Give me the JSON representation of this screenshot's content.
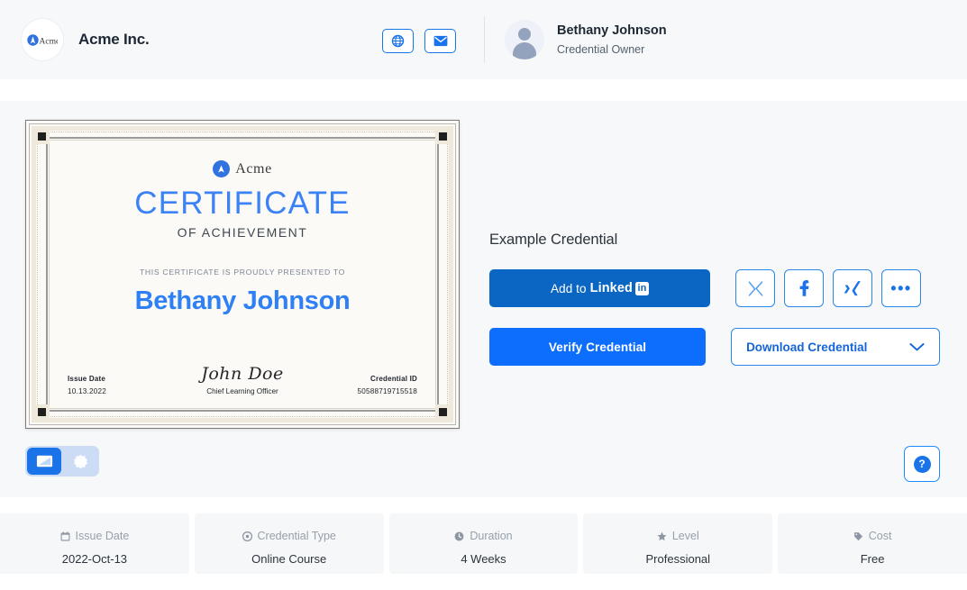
{
  "header": {
    "issuer_name": "Acme Inc.",
    "logo_text": "Acme",
    "actions": [
      {
        "name": "website-button",
        "icon": "globe-icon"
      },
      {
        "name": "email-button",
        "icon": "envelope-icon"
      }
    ],
    "owner": {
      "name": "Bethany Johnson",
      "role": "Credential Owner"
    }
  },
  "certificate": {
    "brand": "Acme",
    "title": "CERTIFICATE",
    "subtitle": "OF ACHIEVEMENT",
    "presented_line": "THIS CERTIFICATE IS PROUDLY PRESENTED TO",
    "recipient": "Bethany Johnson",
    "issue_date_label": "Issue Date",
    "issue_date_value": "10.13.2022",
    "signature_name": "John Doe",
    "signature_role": "Chief Learning Officer",
    "credential_id_label": "Credential ID",
    "credential_id_value": "50588719715518"
  },
  "view_toggle": {
    "options": [
      {
        "name": "certificate-view",
        "icon": "certificate-icon",
        "active": true
      },
      {
        "name": "badge-view",
        "icon": "badge-icon",
        "active": false
      }
    ]
  },
  "help": {
    "label": "?"
  },
  "panel": {
    "title": "Example Credential",
    "linkedin": {
      "prefix": "Add to",
      "brand": "Linked",
      "badge": "in"
    },
    "verify_label": "Verify Credential",
    "download_label": "Download Credential",
    "download_caret": "chevron-down-icon",
    "social": [
      {
        "name": "share-x-button",
        "icon": "x-twitter-icon",
        "glyph": "X"
      },
      {
        "name": "share-facebook-button",
        "icon": "facebook-icon",
        "glyph": "f"
      },
      {
        "name": "share-xing-button",
        "icon": "xing-icon",
        "glyph": "x"
      },
      {
        "name": "share-more-button",
        "icon": "ellipsis-icon",
        "glyph": "•••"
      }
    ]
  },
  "meta": [
    {
      "name": "issue-date",
      "icon": "calendar-icon",
      "label": "Issue Date",
      "value": "2022-Oct-13"
    },
    {
      "name": "credential-type",
      "icon": "disc-icon",
      "label": "Credential Type",
      "value": "Online Course"
    },
    {
      "name": "duration",
      "icon": "clock-icon",
      "label": "Duration",
      "value": "4 Weeks"
    },
    {
      "name": "level",
      "icon": "star-icon",
      "label": "Level",
      "value": "Professional"
    },
    {
      "name": "cost",
      "icon": "tag-icon",
      "label": "Cost",
      "value": "Free"
    }
  ],
  "colors": {
    "accent_blue": "#1a73e8",
    "verify_blue": "#0d6efd",
    "linkedin_blue": "#0a66c2",
    "cert_title_blue": "#3b82f6",
    "page_bg": "#f7f8f9"
  }
}
